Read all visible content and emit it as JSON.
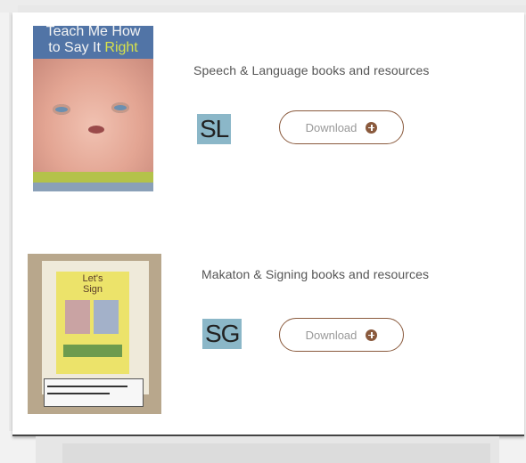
{
  "entries": [
    {
      "title": "Speech & Language books and resources",
      "badge": "SL",
      "download_label": "Download",
      "cover": {
        "title_line1": "Teach Me How",
        "title_line2_pre": "to Say It ",
        "title_line2_highlight": "Right",
        "colors": {
          "band": "#5174a6",
          "strip": "#b4c24a"
        }
      }
    },
    {
      "title": "Makaton & Signing books and resources",
      "badge": "SG",
      "download_label": "Download",
      "cover": {
        "title_line1": "Let's",
        "title_line2": "Sign"
      }
    }
  ],
  "colors": {
    "badge_bg": "#8bb7c8",
    "button_border": "#8a5a3d",
    "button_icon": "#8a5a3d",
    "card_bg": "#ffffff"
  },
  "icons": {
    "download": "plus-circle-icon"
  }
}
